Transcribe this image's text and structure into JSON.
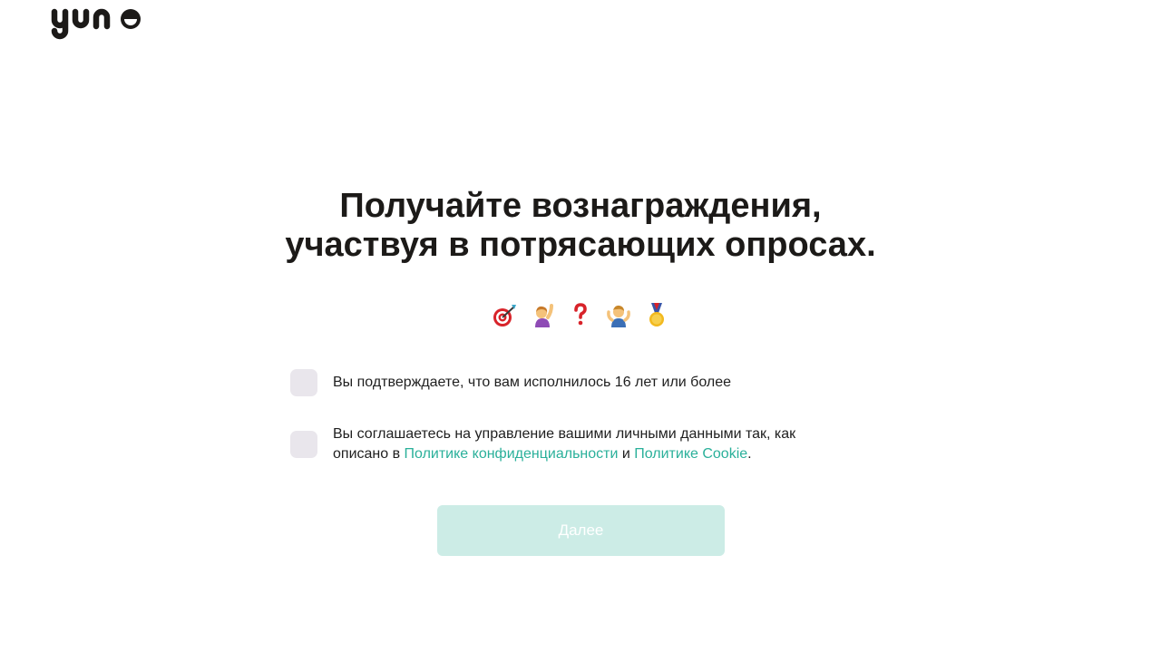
{
  "brand": {
    "name": "yuno"
  },
  "headline": {
    "line1": "Получайте вознаграждения,",
    "line2": "участвуя в потрясающих опросах."
  },
  "emojis": [
    "target-icon",
    "person-raising-hand-icon",
    "question-mark-icon",
    "person-shrugging-icon",
    "medal-icon"
  ],
  "consents": {
    "age": {
      "text": "Вы подтверждаете, что вам исполнилось 16 лет или более",
      "checked": false
    },
    "privacy": {
      "text_before": "Вы соглашаетесь на управление вашими личными данными так, как описано в ",
      "privacy_link": "Политике конфиденциальности",
      "middle": " и ",
      "cookie_link": "Политике Cookie",
      "text_after": ".",
      "checked": false
    }
  },
  "next_button": {
    "label": "Далее",
    "enabled": false
  },
  "colors": {
    "accent": "#2ab09a",
    "button_disabled": "#ccece6",
    "checkbox": "#e9e6ec",
    "text": "#1c1a18"
  }
}
